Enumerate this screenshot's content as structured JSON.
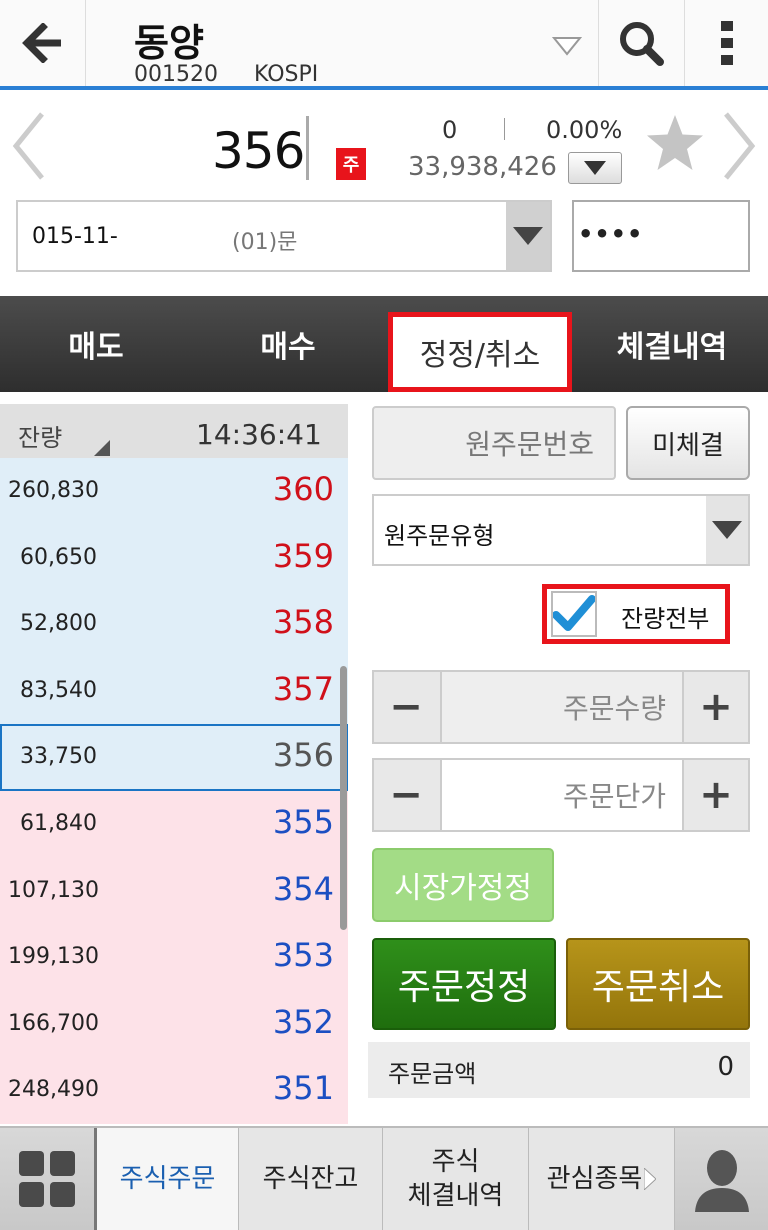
{
  "header": {
    "stock_name": "동양",
    "stock_code": "001520",
    "market": "KOSPI"
  },
  "quote": {
    "price": "356",
    "badge": "주",
    "change": "0",
    "change_rate": "0.00%",
    "volume": "33,938,426"
  },
  "account": {
    "number": "015-11-",
    "type": "(01)문",
    "password": "••••"
  },
  "tabs": [
    {
      "label": "매도"
    },
    {
      "label": "매수"
    },
    {
      "label": "정정/취소",
      "active": true
    },
    {
      "label": "체결내역"
    }
  ],
  "orderbook": {
    "qty_label": "잔량",
    "time": "14:36:41",
    "rows": [
      {
        "qty": "260,830",
        "price": "360",
        "side": "ask"
      },
      {
        "qty": "60,650",
        "price": "359",
        "side": "ask"
      },
      {
        "qty": "52,800",
        "price": "358",
        "side": "ask"
      },
      {
        "qty": "83,540",
        "price": "357",
        "side": "ask"
      },
      {
        "qty": "33,750",
        "price": "356",
        "side": "ask",
        "current": true
      },
      {
        "qty": "61,840",
        "price": "355",
        "side": "bid"
      },
      {
        "qty": "107,130",
        "price": "354",
        "side": "bid"
      },
      {
        "qty": "199,130",
        "price": "353",
        "side": "bid"
      },
      {
        "qty": "166,700",
        "price": "352",
        "side": "bid"
      },
      {
        "qty": "248,490",
        "price": "351",
        "side": "bid"
      }
    ]
  },
  "form": {
    "orig_order_no_placeholder": "원주문번호",
    "unfilled_label": "미체결",
    "orig_order_type_label": "원주문유형",
    "all_remaining_label": "잔량전부",
    "all_remaining_checked": true,
    "qty_placeholder": "주문수량",
    "price_placeholder": "주문단가",
    "minus": "−",
    "plus": "+",
    "market_modify_label": "시장가정정",
    "modify_label": "주문정정",
    "cancel_label": "주문취소",
    "amount_label": "주문금액",
    "amount_value": "0"
  },
  "bottom_nav": [
    {
      "label": "주식주문",
      "active": true
    },
    {
      "label": "주식잔고"
    },
    {
      "label": "주식\n체결내역"
    },
    {
      "label": "관심종목"
    }
  ],
  "colors": {
    "accent": "#2a7fd4",
    "ask_price": "#d0101a",
    "bid_price": "#1c4fc2",
    "highlight": "#e8141b"
  }
}
